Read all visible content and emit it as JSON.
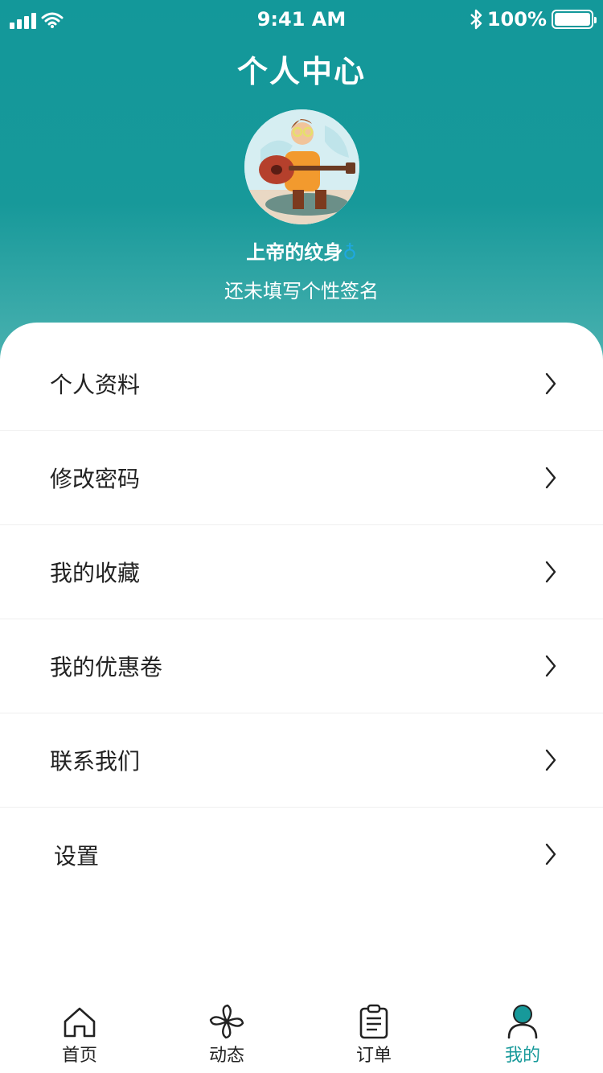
{
  "status_bar": {
    "time": "9:41 AM",
    "battery": "100%",
    "icons": [
      "signal-icon",
      "wifi-icon",
      "bluetooth-icon",
      "battery-icon"
    ]
  },
  "header": {
    "title": "个人中心",
    "username": "上帝的纹身",
    "username_suffix": "♁",
    "signature": "还未填写个性签名"
  },
  "menu": {
    "items": [
      {
        "label": "个人资料"
      },
      {
        "label": "修改密码"
      },
      {
        "label": "我的收藏"
      },
      {
        "label": "我的优惠卷"
      },
      {
        "label": "联系我们"
      },
      {
        "label": "设置"
      }
    ]
  },
  "tabbar": {
    "tabs": [
      {
        "label": "首页",
        "icon": "home-icon"
      },
      {
        "label": "动态",
        "icon": "pinwheel-icon"
      },
      {
        "label": "订单",
        "icon": "clipboard-icon"
      },
      {
        "label": "我的",
        "icon": "user-icon",
        "active": true
      }
    ]
  },
  "colors": {
    "accent": "#17999a",
    "header_top": "#13989a",
    "header_bottom": "#4db3b1",
    "text": "#222222"
  }
}
